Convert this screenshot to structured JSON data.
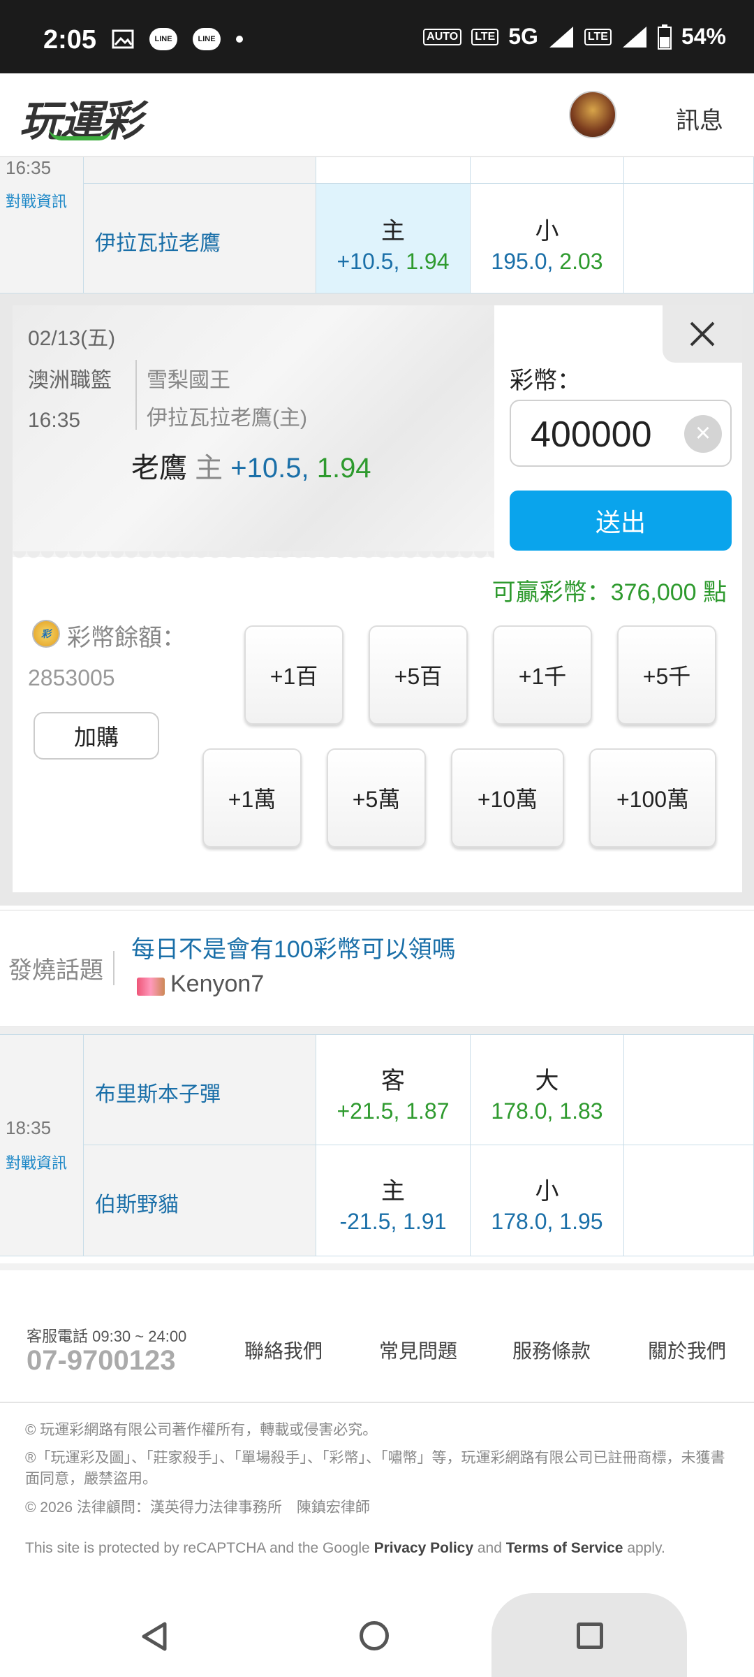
{
  "status_bar": {
    "time": "2:05",
    "network": "5G",
    "sim1": "1",
    "sim2": "2",
    "battery": "54%",
    "line_label": "LINE",
    "auto_label": "AUTO",
    "volte_label": "LTE"
  },
  "header": {
    "logo": "玩運彩",
    "messages_label": "訊息"
  },
  "top_game": {
    "time": "16:35",
    "vs_link": "對戰資訊",
    "team": "伊拉瓦拉老鷹",
    "spread": {
      "side": "主",
      "line": "+10.5",
      "odds": "1.94"
    },
    "total": {
      "side": "小",
      "line": "195.0",
      "odds": "2.03"
    }
  },
  "bet_panel": {
    "date": "02/13(五)",
    "league": "澳洲職籃",
    "time": "16:35",
    "home_team": "雪梨國王",
    "away_team": "伊拉瓦拉老鷹(主)",
    "pick_name": "老鷹",
    "pick_side": "主",
    "pick_line": "+10.5,",
    "pick_odds": "1.94",
    "coin_label": "彩幣：",
    "amount": "400000",
    "submit_label": "送出",
    "win_text": "可贏彩幣：376,000 點",
    "balance_label": "彩幣餘額：",
    "balance": "2853005",
    "coin_icon_text": "彩",
    "add_buy_label": "加購",
    "chips_row1": [
      "+1百",
      "+5百",
      "+1千",
      "+5千"
    ],
    "chips_row2": [
      "+1萬",
      "+5萬",
      "+10萬",
      "+100萬"
    ]
  },
  "hot_topic": {
    "label": "發燒話題",
    "title": "每日不是會有100彩幣可以領嗎",
    "user": "Kenyon7"
  },
  "game2": {
    "time": "18:35",
    "vs_link": "對戰資訊",
    "away_team": "布里斯本子彈",
    "home_team": "伯斯野貓",
    "away_spread": {
      "side": "客",
      "value": "+21.5, 1.87"
    },
    "away_total": {
      "side": "大",
      "value": "178.0, 1.83"
    },
    "home_spread": {
      "side": "主",
      "value": "-21.5, 1.91"
    },
    "home_total": {
      "side": "小",
      "value": "178.0, 1.95"
    }
  },
  "footer": {
    "cs_label": "客服電話 09:30 ~ 24:00",
    "phone": "07-9700123",
    "links": [
      "聯絡我們",
      "常見問題",
      "服務條款",
      "關於我們"
    ],
    "copyright": "© 玩運彩網路有限公司著作權所有，轉載或侵害必究。",
    "trademark": "®「玩運彩及圖」、「莊家殺手」、「單場殺手」、「彩幣」、「嘯幣」等，玩運彩網路有限公司已註冊商標，未獲書面同意，嚴禁盜用。",
    "legal": "© 2026 法律顧問：漢英得力法律事務所　陳鎮宏律師",
    "recaptcha_prefix": "This site is protected by reCAPTCHA and the Google",
    "privacy": "Privacy Policy",
    "and": "and",
    "terms": "Terms of Service",
    "apply": "apply."
  },
  "colors": {
    "accent_blue": "#0aa4ec",
    "odds_green": "#2e9a2e",
    "team_blue": "#1a6fa8"
  }
}
